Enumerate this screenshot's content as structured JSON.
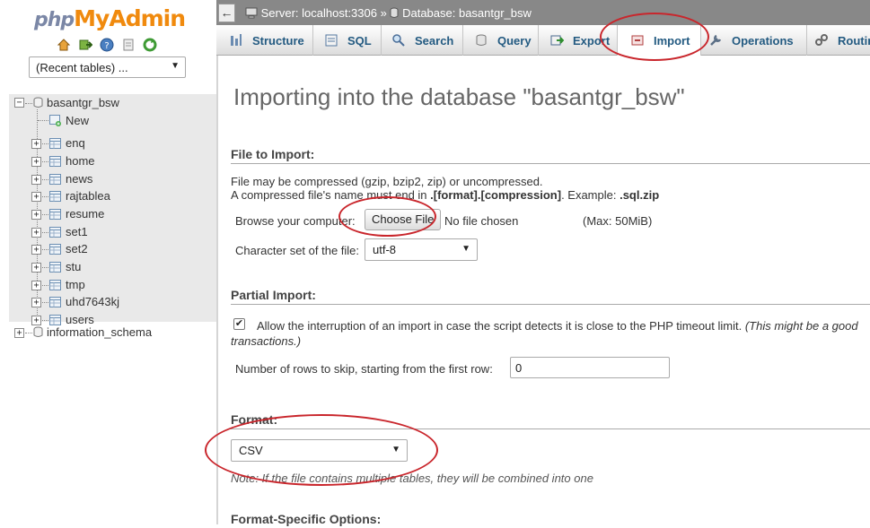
{
  "nav": {
    "logo": {
      "php": "php",
      "my": "My",
      "admin": "Admin"
    },
    "icons": [
      "home-icon",
      "logout-icon",
      "help-icon",
      "docs-icon",
      "reload-icon"
    ],
    "recent_tables": "(Recent tables) ...",
    "tree": {
      "db": "basantgr_bsw",
      "new": "New",
      "tables": [
        "enq",
        "home",
        "news",
        "rajtablea",
        "resume",
        "set1",
        "set2",
        "stu",
        "tmp",
        "uhd7643kj",
        "users"
      ],
      "other_db": "information_schema"
    }
  },
  "topbar": {
    "back": "←",
    "server_label": "Server: localhost:3306",
    "sep": "»",
    "database_label": "Database: basantgr_bsw"
  },
  "tabs": [
    {
      "label": "Structure",
      "icon": "structure-icon"
    },
    {
      "label": "SQL",
      "icon": "sql-icon"
    },
    {
      "label": "Search",
      "icon": "search-icon"
    },
    {
      "label": "Query",
      "icon": "query-icon"
    },
    {
      "label": "Export",
      "icon": "export-icon"
    },
    {
      "label": "Import",
      "icon": "import-icon",
      "active": true
    },
    {
      "label": "Operations",
      "icon": "wrench-icon"
    },
    {
      "label": "Routines",
      "icon": "routines-icon"
    }
  ],
  "main": {
    "title": "Importing into the database \"basantgr_bsw\"",
    "file_section": {
      "heading": "File to Import:",
      "line1": "File may be compressed (gzip, bzip2, zip) or uncompressed.",
      "line2_pre": "A compressed file's name must end in ",
      "line2_bold": ".[format].[compression]",
      "line2_mid": ". Example: ",
      "line2_ex": ".sql.zip",
      "browse_label": "Browse your computer:",
      "choose_button": "Choose File",
      "no_file": "No file chosen",
      "max": "(Max: 50MiB)",
      "charset_label": "Character set of the file:",
      "charset_value": "utf-8"
    },
    "partial_section": {
      "heading": "Partial Import:",
      "allow_checked": true,
      "allow_text": "Allow the interruption of an import in case the script detects it is close to the PHP timeout limit. ",
      "allow_hint": "(This might be a good",
      "allow_hint2": "transactions.)",
      "skip_label": "Number of rows to skip, starting from the first row:",
      "skip_value": "0"
    },
    "format_section": {
      "heading": "Format:",
      "value": "CSV",
      "note": "Note: If the file contains multiple tables, they will be combined into one"
    },
    "specific_section": {
      "heading": "Format-Specific Options:"
    }
  },
  "colors": {
    "annotation": "#c9262c",
    "tab_text": "#235a81",
    "topbar": "#888888"
  }
}
